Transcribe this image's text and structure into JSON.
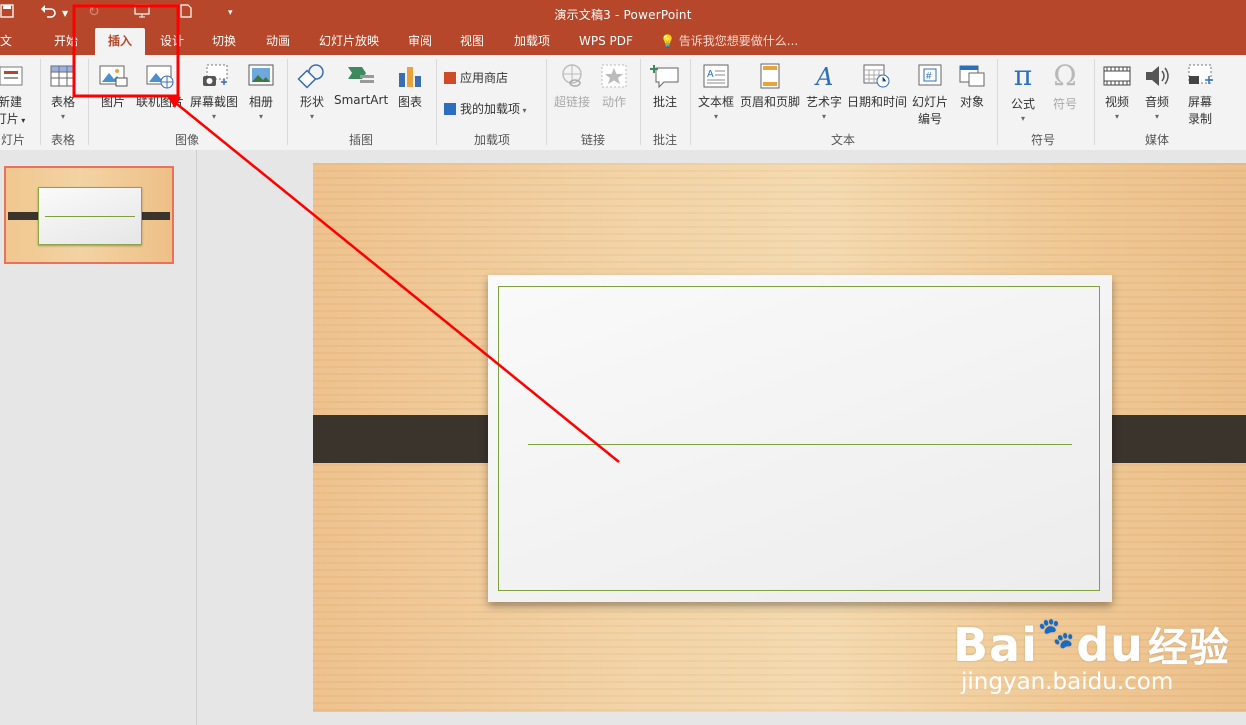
{
  "app": {
    "title": "演示文稿3 - PowerPoint"
  },
  "tabs": [
    "文件",
    "开始",
    "插入",
    "设计",
    "切换",
    "动画",
    "幻灯片放映",
    "审阅",
    "视图",
    "加载项",
    "WPS PDF"
  ],
  "active_tab": "插入",
  "tell_me": "告诉我您想要做什么...",
  "ribbon": {
    "new_slide": {
      "line1": "新建",
      "line2": "灯片"
    },
    "table": "表格",
    "picture": "图片",
    "online_picture": "联机图片",
    "screenshot": "屏幕截图",
    "album": "相册",
    "shapes": "形状",
    "smartart": "SmartArt",
    "chart": "图表",
    "store": "应用商店",
    "my_addins": "我的加载项",
    "hyperlink": "超链接",
    "action": "动作",
    "comment": "批注",
    "textbox": "文本框",
    "header_footer": "页眉和页脚",
    "wordart": "艺术字",
    "datetime": "日期和时间",
    "slide_number": {
      "line1": "幻灯片",
      "line2": "编号"
    },
    "object": "对象",
    "equation": "公式",
    "symbol": "符号",
    "video": "视频",
    "audio": "音频",
    "screen_recording": {
      "line1": "屏幕",
      "line2": "录制"
    }
  },
  "groups": {
    "slides": "灯片",
    "tables": "表格",
    "images": "图像",
    "illustrations": "插图",
    "addins": "加载项",
    "links": "链接",
    "comments": "批注",
    "text": "文本",
    "symbols": "符号",
    "media": "媒体"
  },
  "watermark": {
    "brand": "Bai",
    "brand2": "du",
    "cn": "经验",
    "url": "jingyan.baidu.com"
  },
  "colors": {
    "accent": "#b7472a",
    "annotation": "#ff0000"
  }
}
